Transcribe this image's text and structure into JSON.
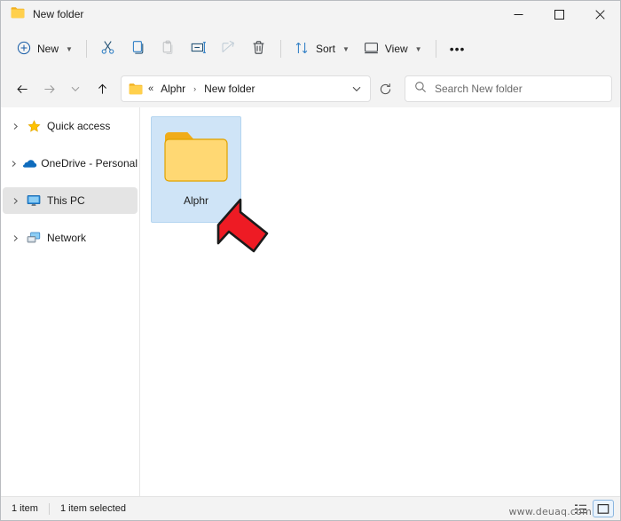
{
  "window": {
    "title": "New folder",
    "title_icon": "folder-icon",
    "controls": {
      "minimize": "─",
      "maximize": "☐",
      "close": "✕"
    }
  },
  "toolbar": {
    "new_label": "New",
    "new_icon": "plus-circle-icon",
    "cut_icon": "scissors-icon",
    "copy_icon": "copy-icon",
    "paste_icon": "paste-icon",
    "rename_icon": "rename-icon",
    "share_icon": "share-icon",
    "delete_icon": "trash-icon",
    "sort_label": "Sort",
    "sort_icon": "sort-arrows-icon",
    "view_label": "View",
    "view_icon": "monitor-icon",
    "more_label": "•••"
  },
  "addressbar": {
    "back_icon": "arrow-left-icon",
    "forward_icon": "arrow-right-icon",
    "recent_icon": "chevron-down-icon",
    "up_icon": "arrow-up-icon",
    "folder_icon": "folder-icon",
    "overflow": "«",
    "crumbs": [
      "Alphr",
      "New folder"
    ],
    "separator": "›",
    "dropdown_icon": "chevron-down-icon",
    "refresh_icon": "refresh-icon"
  },
  "search": {
    "icon": "search-icon",
    "placeholder": "Search New folder",
    "value": ""
  },
  "sidebar": {
    "items": [
      {
        "label": "Quick access",
        "icon": "star-icon",
        "expander": "›",
        "selected": false
      },
      {
        "label": "OneDrive - Personal",
        "icon": "cloud-icon",
        "expander": "›",
        "selected": false
      },
      {
        "label": "This PC",
        "icon": "monitor-icon",
        "expander": "›",
        "selected": true
      },
      {
        "label": "Network",
        "icon": "network-icon",
        "expander": "›",
        "selected": false
      }
    ]
  },
  "content": {
    "items": [
      {
        "name": "Alphr",
        "icon": "folder-icon",
        "selected": true
      }
    ]
  },
  "annotation": {
    "type": "red-arrow",
    "color": "#ee1b24",
    "points_to": "Alphr"
  },
  "status": {
    "item_count": "1 item",
    "selection": "1 item selected",
    "watermark": "www.deuaq.com",
    "view_details_icon": "details-view-icon",
    "view_large_icon": "large-icons-view-icon"
  }
}
